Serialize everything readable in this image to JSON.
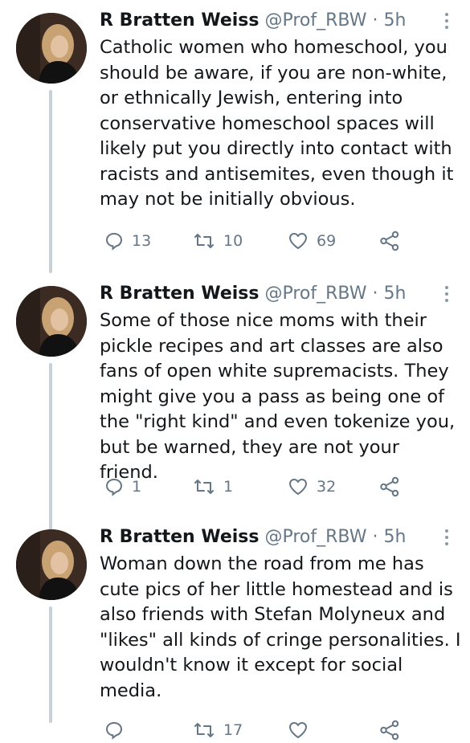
{
  "tweets": [
    {
      "name": "R Bratten Weiss",
      "handle": "@Prof_RBW",
      "time": "· 5h",
      "text": "Catholic women who homeschool, you should be aware, if you are non-white, or ethnically Jewish, entering into conservative homeschool spaces will likely put you directly into contact with racists and antisemites, even though it may not be initially obvious.",
      "replies": "13",
      "retweets": "10",
      "likes": "69"
    },
    {
      "name": "R Bratten Weiss",
      "handle": "@Prof_RBW",
      "time": "· 5h",
      "text": "Some of those nice moms with their pickle recipes and art classes are also fans of open white supremacists. They might give you a pass as being one of the \"right kind\" and even tokenize you, but be warned, they are not your friend.",
      "replies": "1",
      "retweets": "1",
      "likes": "32"
    },
    {
      "name": "R Bratten Weiss",
      "handle": "@Prof_RBW",
      "time": "· 5h",
      "text": "Woman down the road from me has cute pics of her little homestead and is also friends with Stefan Molyneux and \"likes\" all kinds of cringe personalities. I wouldn't know it except for social media.",
      "replies": "",
      "retweets": "17",
      "likes": ""
    }
  ],
  "icons": {
    "reply": "reply-icon",
    "retweet": "retweet-icon",
    "like": "heart-icon",
    "share": "share-icon",
    "more": "more-options-icon"
  },
  "colors": {
    "text": "#14171a",
    "secondary": "#657786",
    "thread_line": "#c8d1d8"
  }
}
